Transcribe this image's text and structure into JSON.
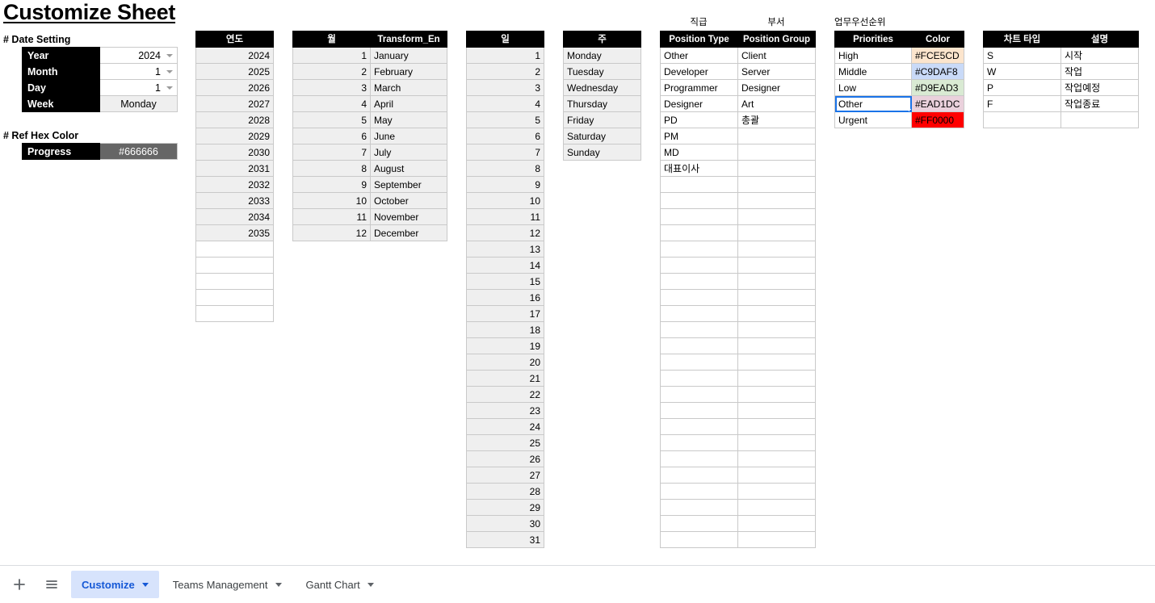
{
  "page": {
    "title": "Customize Sheet"
  },
  "date_setting": {
    "label": "# Date Setting",
    "rows": [
      {
        "key": "Year",
        "value": "2024",
        "dropdown": true
      },
      {
        "key": "Month",
        "value": "1",
        "dropdown": true
      },
      {
        "key": "Day",
        "value": "1",
        "dropdown": true
      },
      {
        "key": "Week",
        "value": "Monday",
        "dropdown": false
      }
    ]
  },
  "ref_hex_color": {
    "label": "# Ref Hex Color",
    "rows": [
      {
        "key": "Progress",
        "value": "#666666",
        "swatch": "#666666"
      }
    ]
  },
  "year_table": {
    "header": "연도",
    "values": [
      "2024",
      "2025",
      "2026",
      "2027",
      "2028",
      "2029",
      "2030",
      "2031",
      "2032",
      "2033",
      "2034",
      "2035"
    ],
    "blank_rows": 5
  },
  "month_table": {
    "headers": [
      "월",
      "Transform_En"
    ],
    "rows": [
      {
        "num": "1",
        "en": "January"
      },
      {
        "num": "2",
        "en": "February"
      },
      {
        "num": "3",
        "en": "March"
      },
      {
        "num": "4",
        "en": "April"
      },
      {
        "num": "5",
        "en": "May"
      },
      {
        "num": "6",
        "en": "June"
      },
      {
        "num": "7",
        "en": "July"
      },
      {
        "num": "8",
        "en": "August"
      },
      {
        "num": "9",
        "en": "September"
      },
      {
        "num": "10",
        "en": "October"
      },
      {
        "num": "11",
        "en": "November"
      },
      {
        "num": "12",
        "en": "December"
      }
    ]
  },
  "day_table": {
    "header": "일",
    "values": [
      "1",
      "2",
      "3",
      "4",
      "5",
      "6",
      "7",
      "8",
      "9",
      "10",
      "11",
      "12",
      "13",
      "14",
      "15",
      "16",
      "17",
      "18",
      "19",
      "20",
      "21",
      "22",
      "23",
      "24",
      "25",
      "26",
      "27",
      "28",
      "29",
      "30",
      "31"
    ]
  },
  "week_table": {
    "header": "주",
    "values": [
      "Monday",
      "Tuesday",
      "Wednesday",
      "Thursday",
      "Friday",
      "Saturday",
      "Sunday"
    ]
  },
  "position_table": {
    "captions": [
      "직급",
      "부서"
    ],
    "headers": [
      "Position Type",
      "Position Group"
    ],
    "rows": [
      {
        "type": "Other",
        "group": "Client"
      },
      {
        "type": "Developer",
        "group": "Server"
      },
      {
        "type": "Programmer",
        "group": "Designer"
      },
      {
        "type": "Designer",
        "group": "Art"
      },
      {
        "type": "PD",
        "group": "총괄"
      },
      {
        "type": "PM",
        "group": ""
      },
      {
        "type": "MD",
        "group": ""
      },
      {
        "type": "대표이사",
        "group": ""
      }
    ],
    "blank_rows": 23
  },
  "priority_table": {
    "caption": "업무우선순위",
    "headers": [
      "Priorities",
      "Color"
    ],
    "rows": [
      {
        "priority": "High",
        "color": "#FCE5CD",
        "swatch": "#FCE5CD",
        "selected": false
      },
      {
        "priority": "Middle",
        "color": "#C9DAF8",
        "swatch": "#C9DAF8",
        "selected": false
      },
      {
        "priority": "Low",
        "color": "#D9EAD3",
        "swatch": "#D9EAD3",
        "selected": false
      },
      {
        "priority": "Other",
        "color": "#EAD1DC",
        "swatch": "#EAD1DC",
        "selected": true
      },
      {
        "priority": "Urgent",
        "color": "#FF0000",
        "swatch": "#FF0000",
        "selected": false
      }
    ]
  },
  "chart_type_table": {
    "headers": [
      "차트 타입",
      "설명"
    ],
    "rows": [
      {
        "code": "S",
        "desc": "시작"
      },
      {
        "code": "W",
        "desc": "작업"
      },
      {
        "code": "P",
        "desc": "작업예정"
      },
      {
        "code": "F",
        "desc": "작업종료"
      }
    ],
    "blank_rows": 1
  },
  "tabbar": {
    "add_label": "+",
    "all_sheets_icon": "hamburger-icon",
    "tabs": [
      {
        "label": "Customize",
        "active": true
      },
      {
        "label": "Teams Management",
        "active": false
      },
      {
        "label": "Gantt Chart",
        "active": false
      }
    ]
  }
}
